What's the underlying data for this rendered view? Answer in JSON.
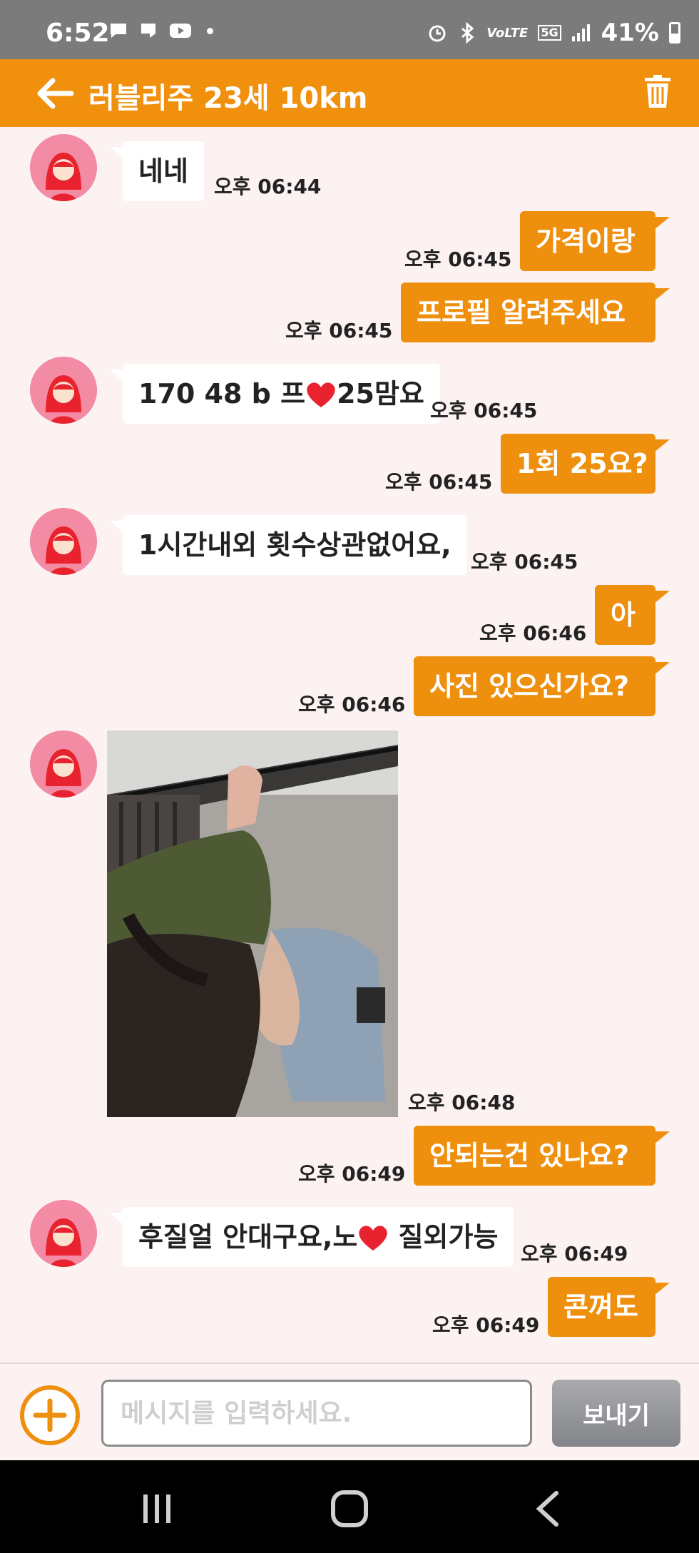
{
  "status_bar": {
    "time": "6:52",
    "left_icons": [
      "chat-icon",
      "message-icon",
      "youtube-icon",
      "dot-icon"
    ],
    "volte": "VoLTE",
    "network": "5G",
    "battery": "41%"
  },
  "header": {
    "title": "러블리주 23세 10km",
    "back_icon": "arrow-left-icon",
    "trash_icon": "trash-icon",
    "background": "#f0900c"
  },
  "messages": [
    {
      "side": "in",
      "text": "네네",
      "time": "오후 06:44"
    },
    {
      "side": "out",
      "text": "가격이랑",
      "time": "오후 06:45"
    },
    {
      "side": "out",
      "text": "프로필 알려주세요",
      "time": "오후 06:45"
    },
    {
      "side": "in",
      "text_before": "170 48 b 프",
      "text_after": "25맘요",
      "emoji": "heart",
      "time": "오후 06:45"
    },
    {
      "side": "out",
      "text": "1회 25요?",
      "time": "오후 06:45"
    },
    {
      "side": "in",
      "text": "1시간내외 횟수상관없어요,",
      "time": "오후 06:45"
    },
    {
      "side": "out",
      "text": "아",
      "time": "오후 06:46"
    },
    {
      "side": "out",
      "text": "사진 있으신가요?",
      "time": "오후 06:46"
    },
    {
      "side": "in",
      "type": "image",
      "time": "오후 06:48"
    },
    {
      "side": "out",
      "text": "안되는건 있나요?",
      "time": "오후 06:49"
    },
    {
      "side": "in",
      "text_before": "후질얼 안대구요,노",
      "text_after": " 질외가능",
      "emoji": "heart",
      "time": "오후 06:49"
    },
    {
      "side": "out",
      "text": "콘껴도",
      "time": "오후 06:49"
    }
  ],
  "input": {
    "placeholder": "메시지를 입력하세요.",
    "value": "",
    "send_label": "보내기",
    "add_icon": "plus-circle-icon"
  },
  "colors": {
    "accent": "#ef8f0e",
    "chat_bg": "#fdf2f2",
    "heart": "#e8232f"
  },
  "nav_bar": [
    "recents-icon",
    "home-icon",
    "back-icon"
  ]
}
